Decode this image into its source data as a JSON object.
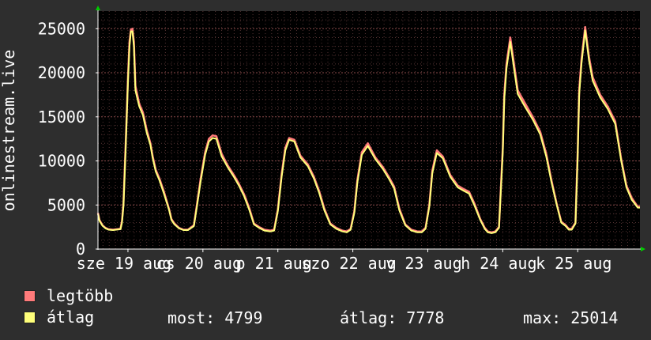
{
  "chart_data": {
    "type": "line",
    "ylabel": "onlinestream.live",
    "ylim": [
      0,
      27000
    ],
    "yticks": [
      0,
      5000,
      10000,
      15000,
      20000,
      25000
    ],
    "x_tick_labels": [
      "sze 19 aug",
      "cs 20 aug",
      "p 21 aug",
      "szo 22 aug",
      "v 23 aug",
      "h 24 aug",
      "k 25 aug"
    ],
    "x_day_range": [
      18.6,
      25.83
    ],
    "grid": true,
    "series": [
      {
        "name": "legtöbb",
        "color": "#ff7a7a",
        "x": [
          18.6,
          18.62,
          18.66,
          18.7,
          18.74,
          18.8,
          18.9,
          18.92,
          18.94,
          18.97,
          19.0,
          19.02,
          19.04,
          19.06,
          19.08,
          19.1,
          19.15,
          19.2,
          19.25,
          19.3,
          19.33,
          19.37,
          19.42,
          19.48,
          19.55,
          19.58,
          19.62,
          19.68,
          19.74,
          19.8,
          19.88,
          19.92,
          19.97,
          20.03,
          20.08,
          20.13,
          20.18,
          20.25,
          20.33,
          20.42,
          20.48,
          20.55,
          20.62,
          20.68,
          20.75,
          20.82,
          20.9,
          20.95,
          21.0,
          21.05,
          21.1,
          21.15,
          21.22,
          21.3,
          21.4,
          21.48,
          21.55,
          21.62,
          21.7,
          21.78,
          21.86,
          21.92,
          21.97,
          22.02,
          22.06,
          22.12,
          22.2,
          22.3,
          22.4,
          22.48,
          22.55,
          22.62,
          22.7,
          22.78,
          22.86,
          22.92,
          22.97,
          23.02,
          23.06,
          23.12,
          23.2,
          23.3,
          23.4,
          23.48,
          23.55,
          23.62,
          23.7,
          23.76,
          23.8,
          23.85,
          23.9,
          23.95,
          24.0,
          24.02,
          24.05,
          24.1,
          24.15,
          24.2,
          24.3,
          24.4,
          24.5,
          24.58,
          24.65,
          24.72,
          24.78,
          24.84,
          24.88,
          24.92,
          24.97,
          25.0,
          25.02,
          25.05,
          25.1,
          25.15,
          25.2,
          25.3,
          25.4,
          25.5,
          25.58,
          25.65,
          25.72,
          25.8,
          25.83
        ],
        "y": [
          4100,
          3300,
          2700,
          2400,
          2250,
          2200,
          2300,
          3200,
          5200,
          12000,
          19500,
          23500,
          24900,
          25000,
          23500,
          18500,
          16500,
          15500,
          13500,
          12000,
          10500,
          9000,
          8000,
          6500,
          4500,
          3400,
          2900,
          2400,
          2200,
          2200,
          2700,
          5000,
          8000,
          11000,
          12500,
          12900,
          12800,
          10800,
          9500,
          8300,
          7400,
          6200,
          4600,
          2900,
          2500,
          2200,
          2100,
          2200,
          4500,
          8500,
          11500,
          12600,
          12400,
          10600,
          9600,
          8200,
          6600,
          4600,
          2900,
          2400,
          2100,
          2000,
          2300,
          4300,
          7800,
          11000,
          12000,
          10400,
          9300,
          8200,
          7100,
          4600,
          2800,
          2200,
          2000,
          2000,
          2400,
          5000,
          8900,
          11200,
          10500,
          8400,
          7200,
          6800,
          6500,
          5200,
          3400,
          2400,
          2000,
          1900,
          2000,
          2500,
          11500,
          17500,
          21000,
          24000,
          21000,
          18000,
          16500,
          15000,
          13300,
          10800,
          7800,
          5100,
          3100,
          2700,
          2300,
          2300,
          3000,
          11000,
          18000,
          21500,
          25200,
          21800,
          19500,
          17500,
          16200,
          14500,
          10200,
          7200,
          5800,
          4800,
          4800
        ]
      },
      {
        "name": "átlag",
        "color": "#ffff7a",
        "x": [
          18.6,
          18.62,
          18.66,
          18.7,
          18.74,
          18.8,
          18.9,
          18.92,
          18.94,
          18.97,
          19.0,
          19.02,
          19.04,
          19.06,
          19.08,
          19.1,
          19.15,
          19.2,
          19.25,
          19.3,
          19.33,
          19.37,
          19.42,
          19.48,
          19.55,
          19.58,
          19.62,
          19.68,
          19.74,
          19.8,
          19.88,
          19.92,
          19.97,
          20.03,
          20.08,
          20.13,
          20.18,
          20.25,
          20.33,
          20.42,
          20.48,
          20.55,
          20.62,
          20.68,
          20.75,
          20.82,
          20.9,
          20.95,
          21.0,
          21.05,
          21.1,
          21.15,
          21.22,
          21.3,
          21.4,
          21.48,
          21.55,
          21.62,
          21.7,
          21.78,
          21.86,
          21.92,
          21.97,
          22.02,
          22.06,
          22.12,
          22.2,
          22.3,
          22.4,
          22.48,
          22.55,
          22.62,
          22.7,
          22.78,
          22.86,
          22.92,
          22.97,
          23.02,
          23.06,
          23.12,
          23.2,
          23.3,
          23.4,
          23.48,
          23.55,
          23.62,
          23.7,
          23.76,
          23.8,
          23.85,
          23.9,
          23.95,
          24.0,
          24.02,
          24.05,
          24.1,
          24.15,
          24.2,
          24.3,
          24.4,
          24.5,
          24.58,
          24.65,
          24.72,
          24.78,
          24.84,
          24.88,
          24.92,
          24.97,
          25.0,
          25.02,
          25.05,
          25.1,
          25.15,
          25.2,
          25.3,
          25.4,
          25.5,
          25.58,
          25.65,
          25.72,
          25.8,
          25.83
        ],
        "y": [
          4000,
          3200,
          2650,
          2350,
          2200,
          2150,
          2250,
          3000,
          4900,
          11500,
          19000,
          23000,
          24700,
          24700,
          23000,
          18000,
          16200,
          15200,
          13200,
          11800,
          10300,
          8800,
          7800,
          6300,
          4400,
          3300,
          2800,
          2350,
          2150,
          2150,
          2600,
          4800,
          7700,
          10700,
          12200,
          12600,
          12500,
          10500,
          9300,
          8100,
          7200,
          6000,
          4400,
          2800,
          2400,
          2100,
          2000,
          2100,
          4300,
          8200,
          11200,
          12400,
          12200,
          10400,
          9400,
          8000,
          6400,
          4400,
          2800,
          2300,
          2000,
          1900,
          2200,
          4100,
          7500,
          10700,
          11700,
          10200,
          9100,
          8000,
          6900,
          4400,
          2700,
          2100,
          1900,
          1900,
          2300,
          4800,
          8600,
          10900,
          10300,
          8200,
          7000,
          6600,
          6300,
          5000,
          3300,
          2300,
          1900,
          1800,
          1900,
          2400,
          11000,
          17000,
          20500,
          23500,
          20500,
          17600,
          16100,
          14700,
          13000,
          10500,
          7600,
          5000,
          3000,
          2600,
          2200,
          2200,
          2900,
          10500,
          17500,
          21000,
          24800,
          21400,
          19100,
          17200,
          15900,
          14200,
          10000,
          7000,
          5600,
          4700,
          4700
        ]
      }
    ]
  },
  "legend": {
    "max_label": "legtöbb",
    "avg_label": "átlag",
    "max_color": "#ff7a7a",
    "avg_color": "#ffff7a"
  },
  "stats": {
    "now_label": "most:",
    "now_value": "4799",
    "avg_label": "átlag:",
    "avg_value": "7778",
    "max_label": "max:",
    "max_value": "25014"
  }
}
